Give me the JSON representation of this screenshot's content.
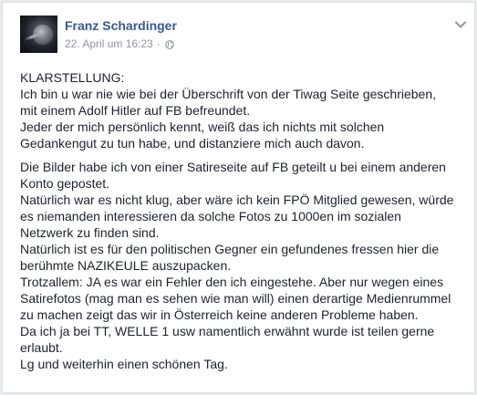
{
  "post": {
    "author": "Franz Schardinger",
    "timestamp": "22. April um 16:23",
    "separator": "·",
    "privacy_icon": "globe-icon",
    "menu_icon": "chevron-down-icon",
    "paragraph1": [
      "KLARSTELLUNG:",
      "Ich bin u war nie wie bei der Überschrift von der Tiwag Seite geschrieben,",
      "mit einem Adolf Hitler auf FB befreundet.",
      "Jeder der mich persönlich kennt, weiß das ich nichts mit solchen",
      "Gedankengut zu tun habe, und distanziere mich auch davon."
    ],
    "paragraph2": [
      "Die Bilder habe ich von einer Satireseite auf FB geteilt u bei einem anderen",
      "Konto gepostet.",
      "Natürlich war es nicht klug, aber wäre ich kein FPÖ Mitglied gewesen, würde",
      "es niemanden interessieren da solche Fotos zu 1000en im sozialen",
      "Netzwerk zu finden sind.",
      "Natürlich ist es für den politischen Gegner ein gefundenes fressen hier die",
      "berühmte NAZIKEULE auszupacken.",
      "Trotzallem: JA es war ein Fehler den ich eingestehe. Aber nur wegen eines",
      "Satirefotos (mag man es sehen wie man will) einen derartige Medienrummel",
      "zu machen zeigt das wir in Österreich keine anderen Probleme haben.",
      "Da ich ja bei TT, WELLE 1 usw namentlich erwähnt wurde ist teilen gerne",
      "erlaubt.",
      "Lg und weiterhin einen schönen Tag."
    ]
  },
  "colors": {
    "author_link": "#365899",
    "meta_text": "#90949c",
    "body_text": "#1d2129",
    "background": "#e9ebee"
  }
}
